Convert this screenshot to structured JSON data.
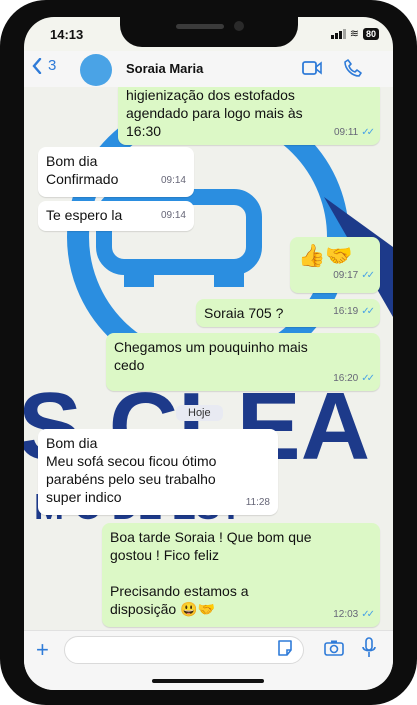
{
  "status": {
    "time": "14:13",
    "battery": "80"
  },
  "header": {
    "back_count": "3",
    "contact_name": "Soraia Maria"
  },
  "day_separator": "Hoje",
  "messages": [
    {
      "side": "out",
      "text": "higienização dos estofados\nagendado para logo mais às\n16:30",
      "time": "09:11",
      "read": true
    },
    {
      "side": "in",
      "text": "Bom dia\nConfirmado",
      "time": "09:14"
    },
    {
      "side": "in",
      "text": "Te espero la",
      "time": "09:14"
    },
    {
      "side": "out",
      "text": "👍🤝",
      "time": "09:17",
      "read": true
    },
    {
      "side": "out",
      "text": "Soraia 705 ?",
      "time": "16:19",
      "read": true
    },
    {
      "side": "out",
      "text": "Chegamos um pouquinho mais\ncedo",
      "time": "16:20",
      "read": true
    },
    {
      "side": "in",
      "text": "Bom dia\nMeu sofá secou ficou ótimo\nparabéns pelo seu trabalho\nsuper indico",
      "time": "11:28"
    },
    {
      "side": "out",
      "text": "Boa tarde Soraia ! Que bom que\ngostou ! Fico feliz\n\nPrecisando estamos a\ndisposição 😃🤝",
      "time": "12:03",
      "read": true
    }
  ],
  "wallpaper": {
    "logo_letters": "S CLEA",
    "logo_tagline": "M       O DE EST"
  },
  "colors": {
    "accent": "#2f7bd8",
    "outgoing": "#dcf8c6",
    "incoming": "#ffffff",
    "logo_blue": "#2b8ee0",
    "logo_navy": "#1d3a8a"
  },
  "icons": [
    "back-chevron-icon",
    "video-call-icon",
    "phone-call-icon",
    "plus-icon",
    "sticker-icon",
    "camera-icon",
    "microphone-icon"
  ]
}
